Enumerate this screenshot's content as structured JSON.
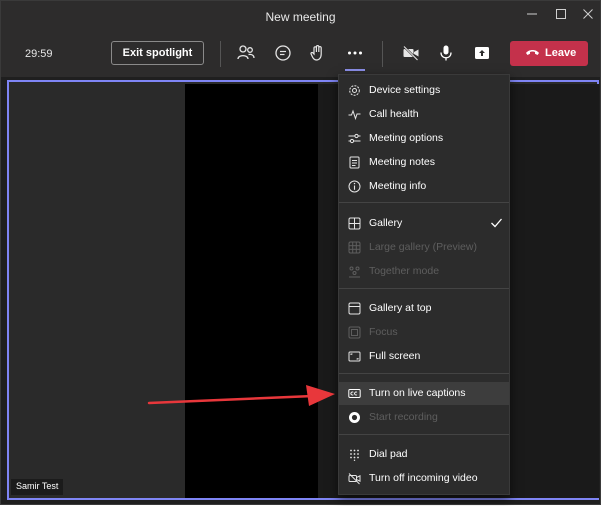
{
  "window": {
    "title": "New meeting",
    "controls": [
      "minimize-icon",
      "maximize-icon",
      "close-icon"
    ]
  },
  "toolbar": {
    "timer": "29:59",
    "exit_spotlight_label": "Exit spotlight",
    "icons": [
      "people-icon",
      "chat-icon",
      "raise-hand-icon",
      "more-icon",
      "camera-off-icon",
      "microphone-icon",
      "share-icon"
    ],
    "leave_label": "Leave"
  },
  "participant": {
    "name": "Samir Test"
  },
  "menu": {
    "sections": [
      [
        {
          "label": "Device settings",
          "icon": "gear-icon",
          "enabled": true
        },
        {
          "label": "Call health",
          "icon": "pulse-icon",
          "enabled": true
        },
        {
          "label": "Meeting options",
          "icon": "sliders-icon",
          "enabled": true
        },
        {
          "label": "Meeting notes",
          "icon": "notes-icon",
          "enabled": true
        },
        {
          "label": "Meeting info",
          "icon": "info-icon",
          "enabled": true
        }
      ],
      [
        {
          "label": "Gallery",
          "icon": "gallery-icon",
          "enabled": true,
          "checked": true
        },
        {
          "label": "Large gallery (Preview)",
          "icon": "large-gallery-icon",
          "enabled": false
        },
        {
          "label": "Together mode",
          "icon": "together-mode-icon",
          "enabled": false
        }
      ],
      [
        {
          "label": "Gallery at top",
          "icon": "gallery-top-icon",
          "enabled": true
        },
        {
          "label": "Focus",
          "icon": "focus-icon",
          "enabled": false
        },
        {
          "label": "Full screen",
          "icon": "fullscreen-icon",
          "enabled": true
        }
      ],
      [
        {
          "label": "Turn on live captions",
          "icon": "captions-icon",
          "enabled": true,
          "highlighted": true
        },
        {
          "label": "Start recording",
          "icon": "record-icon",
          "enabled": false
        }
      ],
      [
        {
          "label": "Dial pad",
          "icon": "dialpad-icon",
          "enabled": true
        },
        {
          "label": "Turn off incoming video",
          "icon": "video-off-icon",
          "enabled": true
        }
      ]
    ]
  },
  "colors": {
    "accent": "#7f85f5",
    "leave": "#c4314b",
    "annotation_arrow": "#e8373b"
  }
}
